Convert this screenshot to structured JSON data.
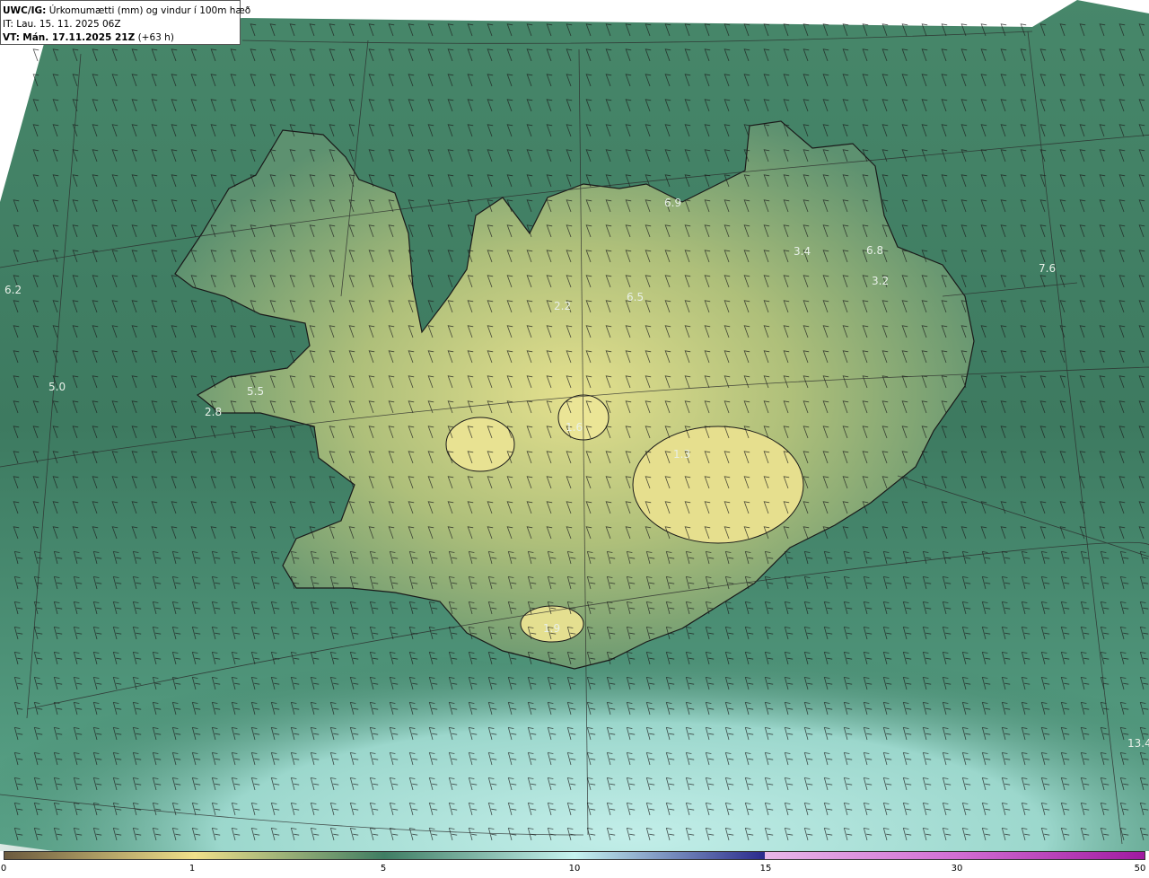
{
  "header": {
    "model": "UWC/IG:",
    "description": "Úrkomumætti (mm) og vindur í 100m hæð",
    "initial_time": "IT: Lau. 15. 11. 2025 06Z",
    "valid_prefix": "VT:",
    "valid_time": "Mán. 17.11.2025 21Z",
    "lead_time": "(+63 h)"
  },
  "map_labels": [
    {
      "text": "6.9"
    },
    {
      "text": "3.4"
    },
    {
      "text": "6.8"
    },
    {
      "text": "7.6"
    },
    {
      "text": "3.2"
    },
    {
      "text": "2.2"
    },
    {
      "text": "6.5"
    },
    {
      "text": "6.2"
    },
    {
      "text": "5.0"
    },
    {
      "text": "5.5"
    },
    {
      "text": "2.8"
    },
    {
      "text": "1.6"
    },
    {
      "text": "1.3"
    },
    {
      "text": "1.9"
    },
    {
      "text": "13.4"
    }
  ],
  "colorbar": {
    "ticks": [
      "0",
      "1",
      "5",
      "10",
      "15",
      "30",
      "50"
    ],
    "colors": {
      "low": "#6b5a3e",
      "mid_low": "#f0e08a",
      "mid": "#3f7d63",
      "high": "#c6f3f0",
      "very_high": "#2a2a8c",
      "max": "#a01aa0"
    }
  },
  "colors": {
    "sea": "#3d7a60",
    "land": "#8fab6a",
    "precip_light": "#a9e3d8",
    "precip_heavy": "#4b4fa8"
  }
}
